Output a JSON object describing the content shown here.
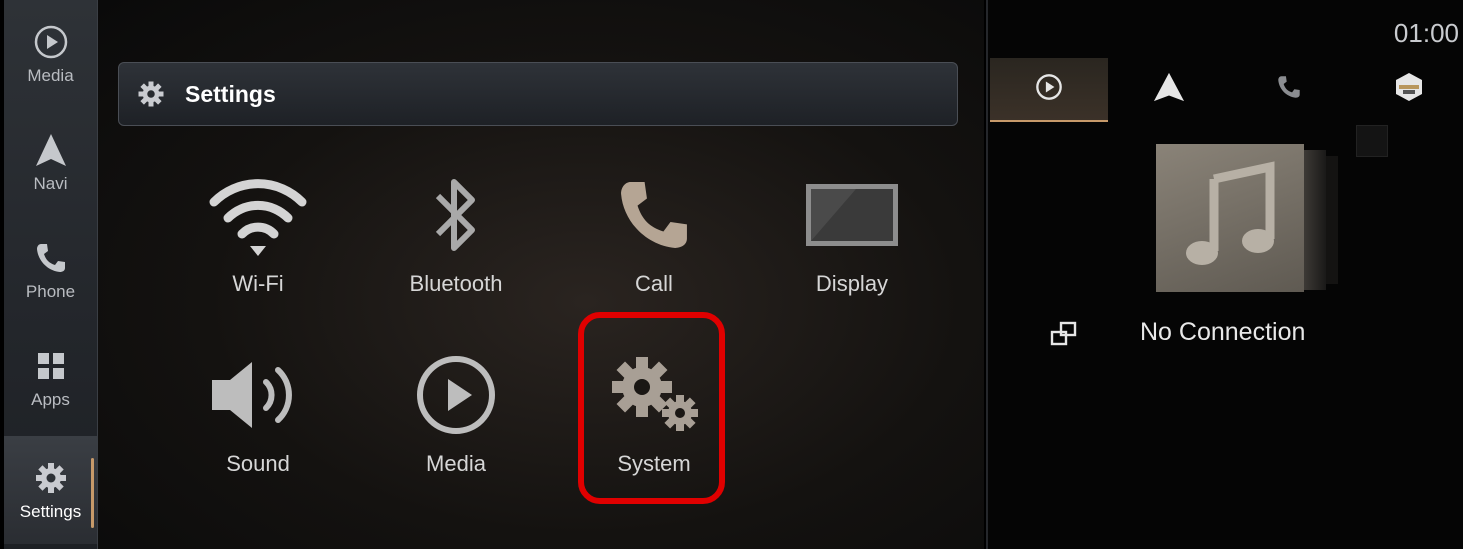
{
  "nav": {
    "items": [
      {
        "label": "Media",
        "icon": "play-circle-icon"
      },
      {
        "label": "Navi",
        "icon": "navigation-arrow-icon"
      },
      {
        "label": "Phone",
        "icon": "phone-icon"
      },
      {
        "label": "Apps",
        "icon": "apps-grid-icon"
      },
      {
        "label": "Settings",
        "icon": "gear-icon",
        "active": true
      }
    ]
  },
  "header": {
    "title": "Settings",
    "icon": "gear-icon"
  },
  "tiles": [
    {
      "label": "Wi-Fi",
      "icon": "wifi-icon"
    },
    {
      "label": "Bluetooth",
      "icon": "bluetooth-icon"
    },
    {
      "label": "Call",
      "icon": "phone-icon"
    },
    {
      "label": "Display",
      "icon": "display-icon"
    },
    {
      "label": "Sound",
      "icon": "speaker-icon"
    },
    {
      "label": "Media",
      "icon": "play-circle-icon"
    },
    {
      "label": "System",
      "icon": "gears-icon",
      "highlighted": true
    }
  ],
  "right_panel": {
    "clock": "01:00",
    "tabs": [
      {
        "icon": "play-circle-icon",
        "active": true
      },
      {
        "icon": "navigation-arrow-icon"
      },
      {
        "icon": "phone-icon"
      },
      {
        "icon": "compass-icon"
      }
    ],
    "connection_status": "No Connection",
    "connection_icon": "device-link-icon"
  },
  "colors": {
    "accent": "#c79a6a",
    "highlight": "#e00000"
  }
}
